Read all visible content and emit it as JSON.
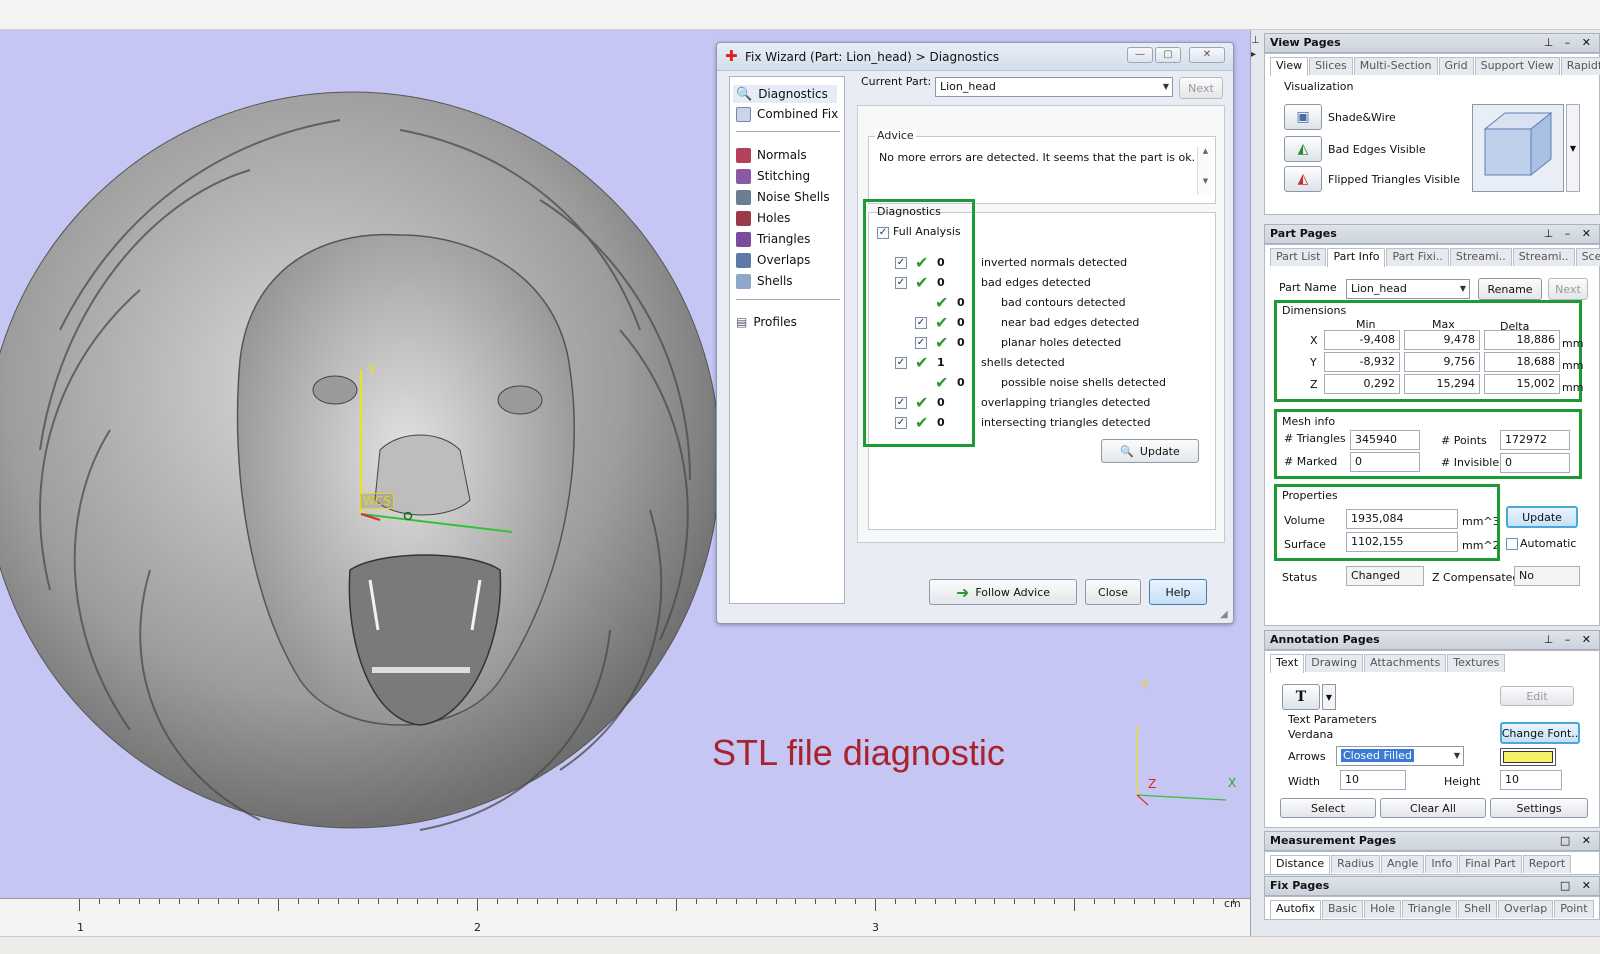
{
  "viewport": {
    "wcs_label": "WCS",
    "axis_y": "Y",
    "axis_x": "X",
    "axis_z": "Z",
    "caption": "STL file diagnostic",
    "ruler": {
      "unit": "cm",
      "labels": [
        "1",
        "2",
        "3"
      ]
    }
  },
  "wizard": {
    "title": "Fix Wizard (Part: Lion_head) > Diagnostics",
    "nav_top": [
      "Diagnostics",
      "Combined Fix"
    ],
    "nav_mid": [
      "Normals",
      "Stitching",
      "Noise Shells",
      "Holes",
      "Triangles",
      "Overlaps",
      "Shells"
    ],
    "nav_bottom": [
      "Profiles"
    ],
    "current_part_label": "Current Part:",
    "current_part_value": "Lion_head",
    "next_label": "Next",
    "advice_label": "Advice",
    "advice_text": "No more errors are detected. It seems that the part is ok.",
    "diagnostics_label": "Diagnostics",
    "full_analysis_label": "Full Analysis",
    "rows": [
      {
        "count": "0",
        "label": "inverted normals detected",
        "checkbox": true,
        "indent": false
      },
      {
        "count": "0",
        "label": "bad edges detected",
        "checkbox": true,
        "indent": false
      },
      {
        "count": "0",
        "label": "bad contours detected",
        "checkbox": false,
        "indent": true
      },
      {
        "count": "0",
        "label": "near bad edges detected",
        "checkbox": true,
        "indent": true
      },
      {
        "count": "0",
        "label": "planar holes detected",
        "checkbox": true,
        "indent": true
      },
      {
        "count": "1",
        "label": "shells detected",
        "checkbox": true,
        "indent": false
      },
      {
        "count": "0",
        "label": "possible noise shells detected",
        "checkbox": false,
        "indent": true
      },
      {
        "count": "0",
        "label": "overlapping triangles detected",
        "checkbox": true,
        "indent": false
      },
      {
        "count": "0",
        "label": "intersecting triangles detected",
        "checkbox": true,
        "indent": false
      }
    ],
    "update_label": "Update",
    "follow_advice_label": "Follow Advice",
    "close_label": "Close",
    "help_label": "Help"
  },
  "view_pages": {
    "title": "View Pages",
    "tabs": [
      "View",
      "Slices",
      "Multi-Section",
      "Grid",
      "Support View",
      "Rapidfit View"
    ],
    "group_label": "Visualization",
    "items": [
      "Shade&Wire",
      "Bad Edges Visible",
      "Flipped Triangles Visible"
    ]
  },
  "part_pages": {
    "title": "Part Pages",
    "tabs": [
      "Part List",
      "Part Info",
      "Part Fixi..",
      "Streami..",
      "Streami..",
      "Scenes"
    ],
    "part_name_label": "Part Name",
    "part_name_value": "Lion_head",
    "rename_label": "Rename",
    "next_label": "Next",
    "dimensions": {
      "label": "Dimensions",
      "headers": [
        "Min",
        "Max",
        "Delta"
      ],
      "rows": [
        {
          "axis": "X",
          "min": "-9,408",
          "max": "9,478",
          "delta": "18,886",
          "unit": "mm"
        },
        {
          "axis": "Y",
          "min": "-8,932",
          "max": "9,756",
          "delta": "18,688",
          "unit": "mm"
        },
        {
          "axis": "Z",
          "min": "0,292",
          "max": "15,294",
          "delta": "15,002",
          "unit": "mm"
        }
      ]
    },
    "mesh_info": {
      "label": "Mesh info",
      "triangles_label": "# Triangles",
      "triangles": "345940",
      "points_label": "# Points",
      "points": "172972",
      "marked_label": "# Marked",
      "marked": "0",
      "invisible_label": "# Invisible",
      "invisible": "0"
    },
    "properties": {
      "label": "Properties",
      "volume_label": "Volume",
      "volume": "1935,084",
      "volume_unit": "mm^3",
      "surface_label": "Surface",
      "surface": "1102,155",
      "surface_unit": "mm^2",
      "update_label": "Update",
      "automatic_label": "Automatic"
    },
    "status_label": "Status",
    "status_value": "Changed",
    "zcomp_label": "Z Compensated",
    "zcomp_value": "No"
  },
  "annotation_pages": {
    "title": "Annotation Pages",
    "tabs": [
      "Text",
      "Drawing",
      "Attachments",
      "Textures"
    ],
    "text_icon": "T",
    "edit_label": "Edit",
    "params_label": "Text Parameters",
    "font_name": "Verdana",
    "change_font_label": "Change Font..",
    "arrows_label": "Arrows",
    "arrows_value": "Closed Filled",
    "arrow_color": "#f5f06a",
    "width_label": "Width",
    "width_value": "10",
    "height_label": "Height",
    "height_value": "10",
    "select_label": "Select",
    "clear_all_label": "Clear All",
    "settings_label": "Settings"
  },
  "measurement_pages": {
    "title": "Measurement Pages",
    "tabs": [
      "Distance",
      "Radius",
      "Angle",
      "Info",
      "Final Part",
      "Report"
    ]
  },
  "fix_pages": {
    "title": "Fix Pages",
    "tabs": [
      "Autofix",
      "Basic",
      "Hole",
      "Triangle",
      "Shell",
      "Overlap",
      "Point"
    ]
  },
  "colors": {
    "viewport_bg": "#c5c6f4",
    "highlight_green": "#1e9a34",
    "caption_red": "#a8232a",
    "check_green": "#2e9a2e"
  }
}
